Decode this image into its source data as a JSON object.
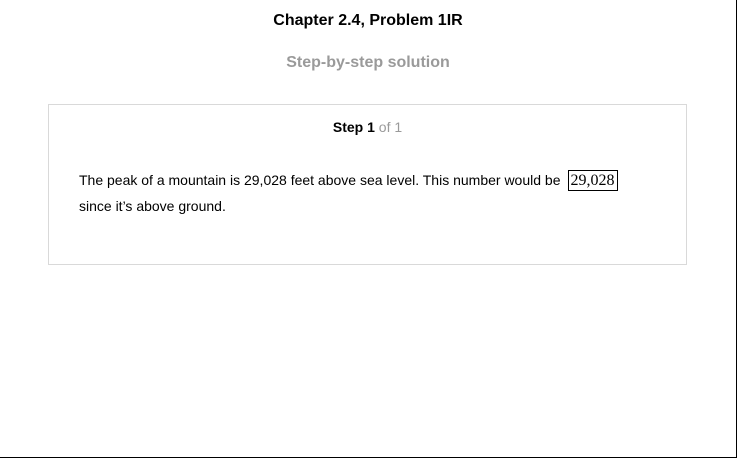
{
  "header": {
    "title": "Chapter 2.4, Problem 1IR",
    "subtitle": "Step-by-step solution"
  },
  "step": {
    "label": "Step",
    "number": "1",
    "of_text": "of 1",
    "text_before": "The peak of a mountain is 29,028 feet above sea level. This number would be",
    "answer": "29,028",
    "text_after": "since it’s above ground."
  }
}
